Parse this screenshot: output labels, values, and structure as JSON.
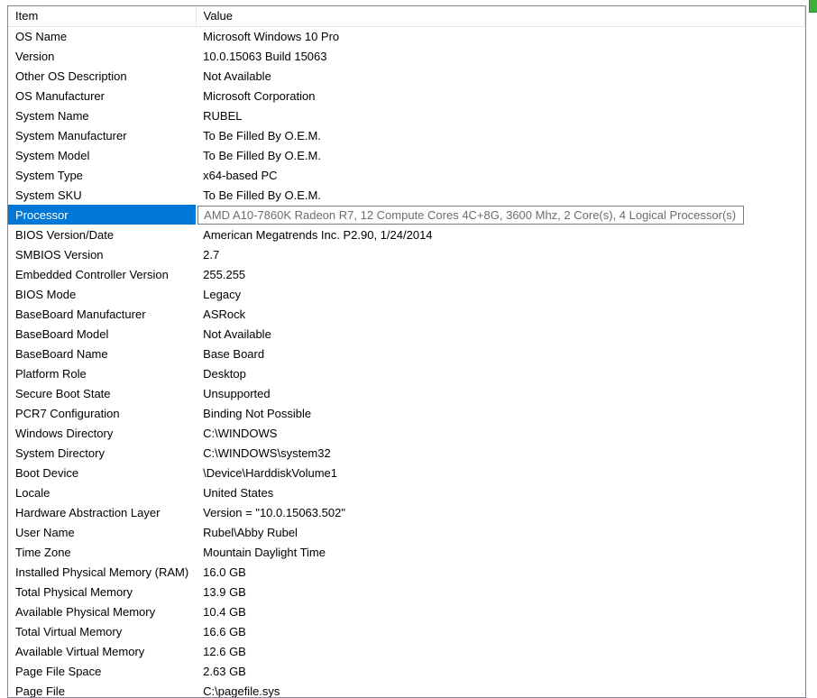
{
  "columns": {
    "item": "Item",
    "value": "Value"
  },
  "selectedIndex": 9,
  "rows": [
    {
      "item": "OS Name",
      "value": "Microsoft Windows 10 Pro"
    },
    {
      "item": "Version",
      "value": "10.0.15063 Build 15063"
    },
    {
      "item": "Other OS Description",
      "value": "Not Available"
    },
    {
      "item": "OS Manufacturer",
      "value": "Microsoft Corporation"
    },
    {
      "item": "System Name",
      "value": "RUBEL"
    },
    {
      "item": "System Manufacturer",
      "value": "To Be Filled By O.E.M."
    },
    {
      "item": "System Model",
      "value": "To Be Filled By O.E.M."
    },
    {
      "item": "System Type",
      "value": "x64-based PC"
    },
    {
      "item": "System SKU",
      "value": "To Be Filled By O.E.M."
    },
    {
      "item": "Processor",
      "value": "AMD A10-7860K Radeon R7, 12 Compute Cores 4C+8G, 3600 Mhz, 2 Core(s), 4 Logical Processor(s)"
    },
    {
      "item": "BIOS Version/Date",
      "value": "American Megatrends Inc. P2.90, 1/24/2014"
    },
    {
      "item": "SMBIOS Version",
      "value": "2.7"
    },
    {
      "item": "Embedded Controller Version",
      "value": "255.255"
    },
    {
      "item": "BIOS Mode",
      "value": "Legacy"
    },
    {
      "item": "BaseBoard Manufacturer",
      "value": "ASRock"
    },
    {
      "item": "BaseBoard Model",
      "value": "Not Available"
    },
    {
      "item": "BaseBoard Name",
      "value": "Base Board"
    },
    {
      "item": "Platform Role",
      "value": "Desktop"
    },
    {
      "item": "Secure Boot State",
      "value": "Unsupported"
    },
    {
      "item": "PCR7 Configuration",
      "value": "Binding Not Possible"
    },
    {
      "item": "Windows Directory",
      "value": "C:\\WINDOWS"
    },
    {
      "item": "System Directory",
      "value": "C:\\WINDOWS\\system32"
    },
    {
      "item": "Boot Device",
      "value": "\\Device\\HarddiskVolume1"
    },
    {
      "item": "Locale",
      "value": "United States"
    },
    {
      "item": "Hardware Abstraction Layer",
      "value": "Version = \"10.0.15063.502\""
    },
    {
      "item": "User Name",
      "value": "Rubel\\Abby Rubel"
    },
    {
      "item": "Time Zone",
      "value": "Mountain Daylight Time"
    },
    {
      "item": "Installed Physical Memory (RAM)",
      "value": "16.0 GB"
    },
    {
      "item": "Total Physical Memory",
      "value": "13.9 GB"
    },
    {
      "item": "Available Physical Memory",
      "value": "10.4 GB"
    },
    {
      "item": "Total Virtual Memory",
      "value": "16.6 GB"
    },
    {
      "item": "Available Virtual Memory",
      "value": "12.6 GB"
    },
    {
      "item": "Page File Space",
      "value": "2.63 GB"
    },
    {
      "item": "Page File",
      "value": "C:\\pagefile.sys"
    }
  ]
}
